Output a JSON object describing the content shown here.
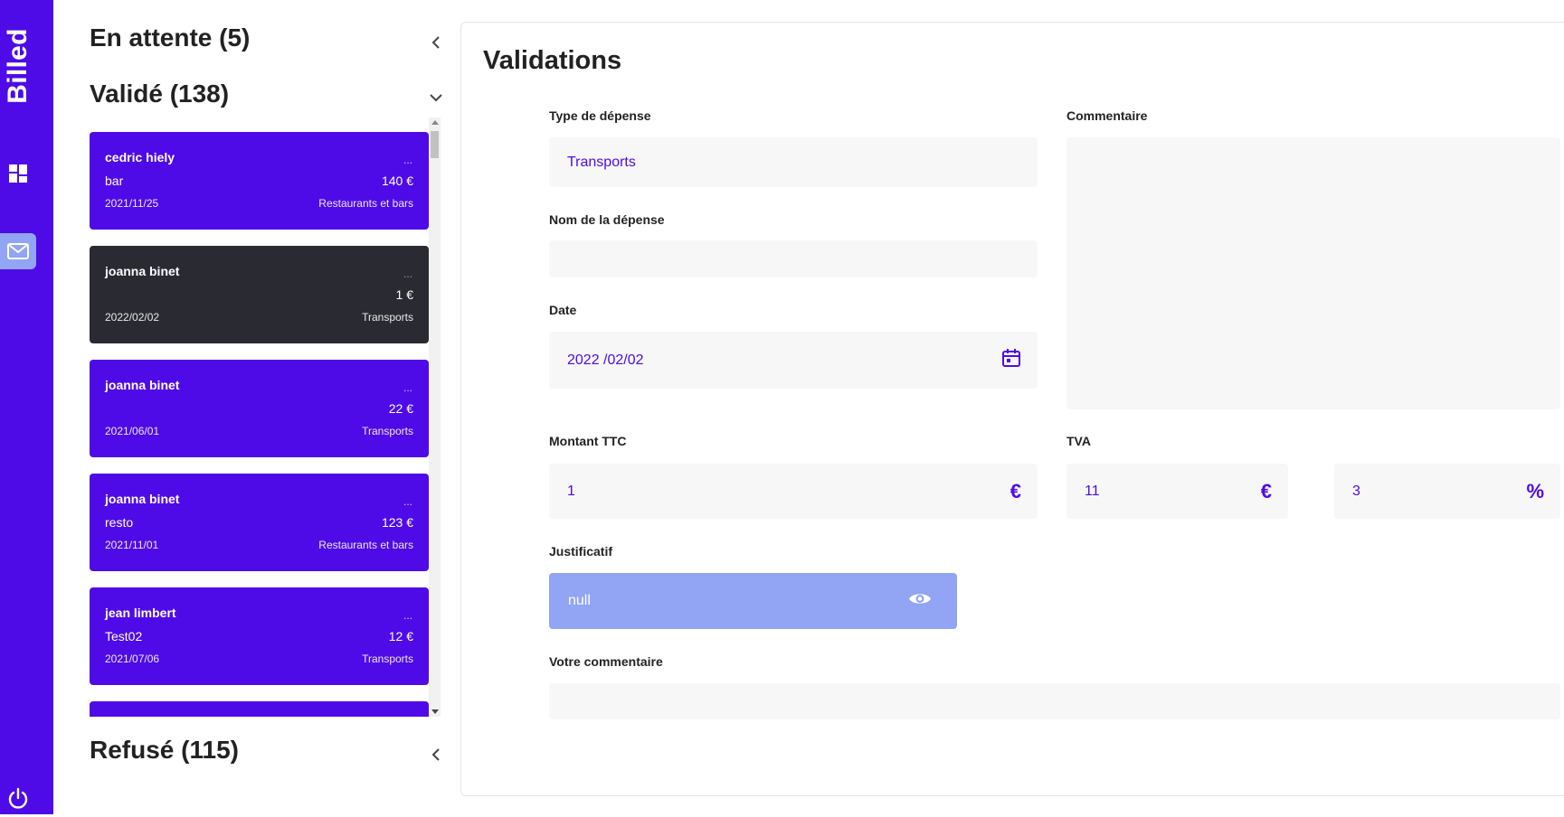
{
  "app": {
    "logo": "Billed"
  },
  "sidebar": {
    "items": [
      {
        "icon": "dashboard-icon"
      },
      {
        "icon": "mail-icon",
        "active": true
      },
      {
        "icon": "power-icon"
      }
    ],
    "colors": {
      "primary": "#4f0be7",
      "active_bg": "#92a4f4"
    }
  },
  "bills": {
    "pending_title": "En attente (5)",
    "validated_title": "Validé (138)",
    "refused_title": "Refusé (115)",
    "cards": [
      {
        "name": "cedric hiely",
        "dots": "...",
        "desc": "bar",
        "amount": "140 €",
        "date": "2021/11/25",
        "type": "Restaurants et bars",
        "active": false
      },
      {
        "name": "joanna binet",
        "dots": "...",
        "desc": "",
        "amount": "1 €",
        "date": "2022/02/02",
        "type": "Transports",
        "active": true
      },
      {
        "name": "joanna binet",
        "dots": "...",
        "desc": "",
        "amount": "22 €",
        "date": "2021/06/01",
        "type": "Transports",
        "active": false
      },
      {
        "name": "joanna binet",
        "dots": "...",
        "desc": "resto",
        "amount": "123 €",
        "date": "2021/11/01",
        "type": "Restaurants et bars",
        "active": false
      },
      {
        "name": "jean limbert",
        "dots": "...",
        "desc": "Test02",
        "amount": "12 €",
        "date": "2021/07/06",
        "type": "Transports",
        "active": false
      }
    ]
  },
  "validation": {
    "title": "Validations",
    "type_label": "Type de dépense",
    "type_value": "Transports",
    "name_label": "Nom de la dépense",
    "name_value": "",
    "date_label": "Date",
    "date_value": "2022 /02/02",
    "amount_label": "Montant TTC",
    "amount_value": "1",
    "amount_icon": "€",
    "vat_label": "TVA",
    "vat_value": "11",
    "vat_icon": "€",
    "pct_value": "3",
    "pct_icon": "%",
    "comment_label": "Commentaire",
    "justif_label": "Justificatif",
    "justif_value": "null",
    "your_comment_label": "Votre commentaire"
  }
}
